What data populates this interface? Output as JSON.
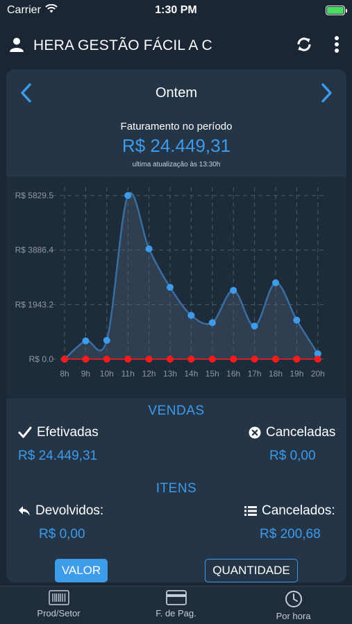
{
  "status_bar": {
    "carrier": "Carrier",
    "time": "1:30 PM"
  },
  "app_bar": {
    "title": "HERA GESTÃO FÁCIL A C",
    "icons": [
      "user-icon",
      "refresh-icon",
      "more-vertical-icon"
    ]
  },
  "period": {
    "label": "Ontem"
  },
  "summary": {
    "label": "Faturamento no período",
    "total": "R$ 24.449,31",
    "updated": "ultima atualização às 13:30h"
  },
  "chart_data": {
    "type": "area",
    "x": [
      "8h",
      "9h",
      "10h",
      "11h",
      "12h",
      "13h",
      "14h",
      "15h",
      "16h",
      "17h",
      "18h",
      "19h",
      "20h"
    ],
    "series": [
      {
        "values": [
          0,
          650,
          670,
          5829.5,
          3930,
          2560,
          1560,
          1300,
          2450,
          1180,
          2720,
          1390,
          190
        ],
        "color": "#3d9be9"
      },
      {
        "values": [
          0,
          0,
          0,
          0,
          0,
          0,
          0,
          0,
          0,
          0,
          0,
          0,
          0
        ],
        "color": "#ff1a1a"
      }
    ],
    "y_ticks": [
      "R$ 0.0",
      "R$ 1943.2",
      "R$ 3886.4",
      "R$ 5829.5"
    ],
    "ylim": [
      0,
      5829.5
    ],
    "grid": true
  },
  "vendas": {
    "title": "VENDAS",
    "efetivadas_label": "Efetivadas",
    "efetivadas_value": "R$ 24.449,31",
    "canceladas_label": "Canceladas",
    "canceladas_value": "R$ 0,00"
  },
  "itens": {
    "title": "ITENS",
    "devolvidos_label": "Devolvidos:",
    "devolvidos_value": "R$ 0,00",
    "cancelados_label": "Cancelados:",
    "cancelados_value": "R$ 200,68"
  },
  "toggle": {
    "valor": "VALOR",
    "quantidade": "QUANTIDADE"
  },
  "tabs": [
    {
      "label": "Prod/Setor",
      "icon": "barcode-icon"
    },
    {
      "label": "F. de Pag.",
      "icon": "credit-card-icon"
    },
    {
      "label": "Por hora",
      "icon": "clock-icon"
    }
  ],
  "colors": {
    "accent": "#3d9be9",
    "background": "#1b2634",
    "card": "#253548",
    "chart_bg": "#1e2b3a",
    "secondary_series": "#ff1a1a"
  }
}
